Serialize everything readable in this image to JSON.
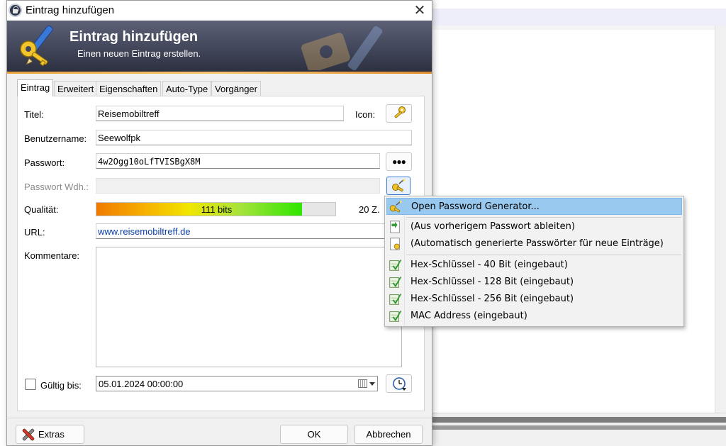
{
  "window": {
    "title": "Eintrag hinzufügen",
    "close_glyph": "✕"
  },
  "banner": {
    "title": "Eintrag hinzufügen",
    "subtitle": "Einen neuen Eintrag erstellen."
  },
  "tabs": [
    {
      "label": "Eintrag",
      "active": true
    },
    {
      "label": "Erweitert",
      "active": false
    },
    {
      "label": "Eigenschaften",
      "active": false
    },
    {
      "label": "Auto-Type",
      "active": false
    },
    {
      "label": "Vorgänger",
      "active": false
    }
  ],
  "form": {
    "title_label": "Titel:",
    "title_value": "Reisemobiltreff",
    "icon_label": "Icon:",
    "username_label": "Benutzername:",
    "username_value": "Seewolfpk",
    "password_label": "Passwort:",
    "password_value": "4w2Ogg10oLfTVISBgX8M",
    "password_toggle_glyph": "●●●",
    "repeat_label": "Passwort Wdh.:",
    "repeat_value": "",
    "quality_label": "Qualität:",
    "quality_text": "111 bits",
    "quality_fraction": 0.86,
    "char_count": "20 Z.",
    "url_label": "URL:",
    "url_value": "www.reisemobiltreff.de",
    "comments_label": "Kommentare:",
    "comments_value": "",
    "expires_label": "Gültig bis:",
    "expires_checked": false,
    "expires_value": "05.01.2024 00:00:00"
  },
  "footer": {
    "extras_label": "Extras",
    "ok_label": "OK",
    "cancel_label": "Abbrechen"
  },
  "menu": {
    "items": [
      {
        "label": "Open Password Generator...",
        "icon": "key-wand-icon",
        "highlighted": true
      },
      {
        "label": "(Aus vorherigem Passwort ableiten)",
        "icon": "derive-icon",
        "highlighted": false
      },
      {
        "label": "(Automatisch generierte Passwörter für neue Einträge)",
        "icon": "auto-generate-icon",
        "highlighted": false
      },
      {
        "label": "Hex-Schlüssel - 40 Bit (eingebaut)",
        "icon": "profile-icon",
        "highlighted": false
      },
      {
        "label": "Hex-Schlüssel - 128 Bit (eingebaut)",
        "icon": "profile-icon",
        "highlighted": false
      },
      {
        "label": "Hex-Schlüssel - 256 Bit (eingebaut)",
        "icon": "profile-icon",
        "highlighted": false
      },
      {
        "label": "MAC Address (eingebaut)",
        "icon": "profile-icon",
        "highlighted": false
      }
    ]
  },
  "colors": {
    "banner_top": "#5c6176",
    "banner_bottom": "#2c3040",
    "menu_highlight": "#99c9ef",
    "url_link": "#0b3ea8"
  }
}
